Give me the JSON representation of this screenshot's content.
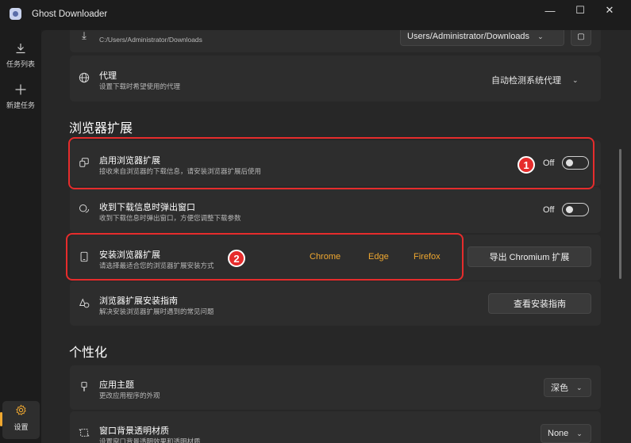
{
  "app": {
    "title": "Ghost Downloader"
  },
  "window_controls": {
    "minimize": "—",
    "maximize": "☐",
    "close": "✕"
  },
  "sidebar": {
    "items": [
      {
        "label": "任务列表",
        "icon": "download-icon"
      },
      {
        "label": "新建任务",
        "icon": "plus-icon"
      },
      {
        "label": "设置",
        "icon": "gear-icon"
      }
    ]
  },
  "download_path": {
    "desc": "C:/Users/Administrator/Downloads",
    "value": "Users/Administrator/Downloads"
  },
  "proxy": {
    "title": "代理",
    "desc": "设置下载时希望使用的代理",
    "value": "自动检测系统代理"
  },
  "browser_ext_section": {
    "title": "浏览器扩展",
    "enable": {
      "title": "启用浏览器扩展",
      "desc": "接收来自浏览器的下载信息，请安装浏览器扩展后使用",
      "toggle": "Off"
    },
    "popup": {
      "title": "收到下载信息时弹出窗口",
      "desc": "收到下载信息时弹出窗口，方便您调整下载参数",
      "toggle": "Off"
    },
    "install": {
      "title": "安装浏览器扩展",
      "desc": "请选择最适合您的浏览器扩展安装方式",
      "browsers": [
        "Chrome",
        "Edge",
        "Firefox"
      ],
      "export_button": "导出 Chromium 扩展"
    },
    "guide": {
      "title": "浏览器扩展安装指南",
      "desc": "解决安装浏览器扩展时遇到的常见问题",
      "button": "查看安装指南"
    }
  },
  "personalization": {
    "title": "个性化",
    "theme": {
      "title": "应用主题",
      "desc": "更改应用程序的外观",
      "value": "深色"
    },
    "material": {
      "title": "窗口背景透明材质",
      "desc": "设置窗口背景透明效果和透明材质",
      "value": "None"
    }
  },
  "annotations": {
    "badge1": "1",
    "badge2": "2"
  },
  "colors": {
    "accent": "#f0a830",
    "highlight": "#e62c2c"
  }
}
